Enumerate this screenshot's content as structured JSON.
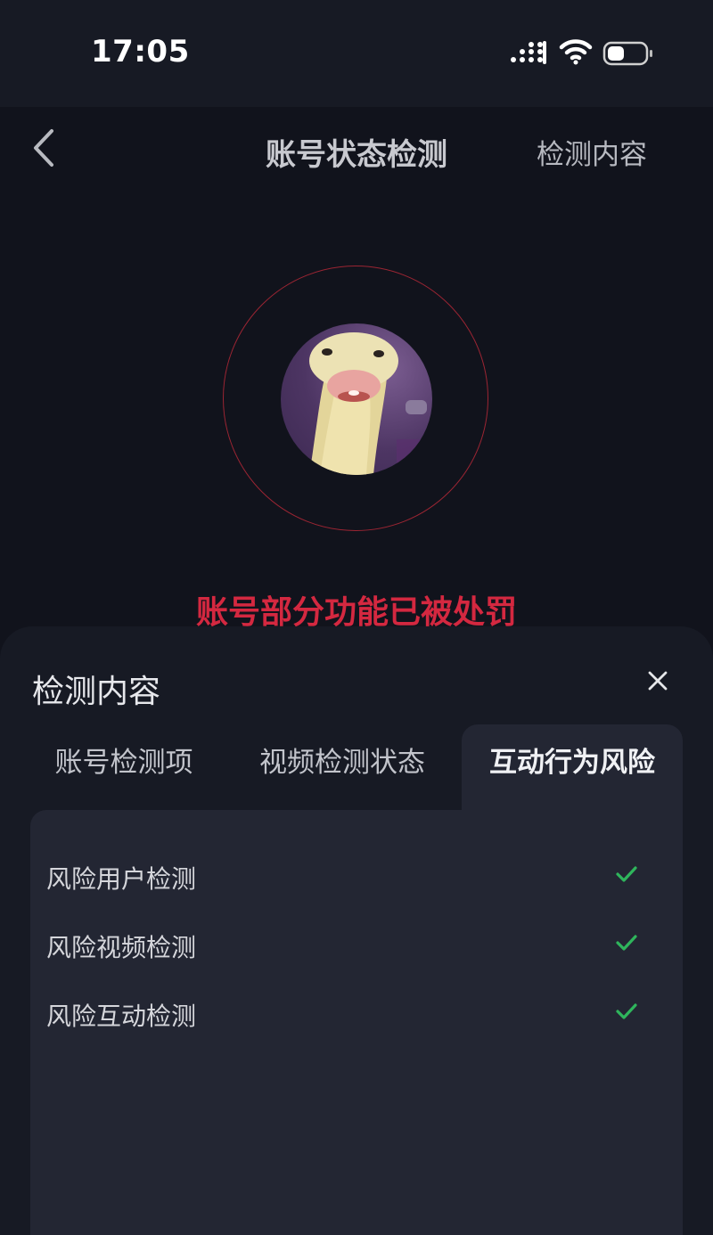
{
  "status_bar": {
    "time": "17:05",
    "icons": [
      "signal-icon",
      "wifi-icon",
      "battery-icon"
    ]
  },
  "nav": {
    "title": "账号状态检测",
    "action": "检测内容",
    "back_icon": "chevron-left-icon"
  },
  "result": {
    "message": "账号部分功能已被处罚",
    "message_color": "#d42840"
  },
  "sheet": {
    "title": "检测内容",
    "close_icon": "close-icon",
    "tabs": [
      {
        "label": "账号检测项",
        "selected": false
      },
      {
        "label": "视频检测状态",
        "selected": false
      },
      {
        "label": "互动行为风险",
        "selected": true
      }
    ],
    "items": [
      {
        "label": "风险用户检测",
        "status_icon": "check-icon"
      },
      {
        "label": "风险视频检测",
        "status_icon": "check-icon"
      },
      {
        "label": "风险互动检测",
        "status_icon": "check-icon"
      }
    ],
    "check_color": "#2fb55c"
  }
}
